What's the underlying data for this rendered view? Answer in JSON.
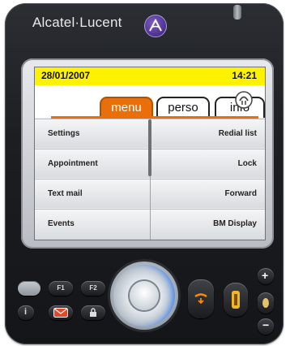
{
  "brand": {
    "name": "Alcatel·Lucent"
  },
  "status": {
    "date": "28/01/2007",
    "time": "14:21"
  },
  "tabs": [
    {
      "label": "menu",
      "active": true
    },
    {
      "label": "perso",
      "active": false
    },
    {
      "label": "info",
      "active": false
    }
  ],
  "menu_left": [
    "Settings",
    "Appointment",
    "Text mail",
    "Events"
  ],
  "menu_right": [
    "Redial list",
    "Lock",
    "Forward",
    "BM Display"
  ],
  "keys": {
    "f1": "F1",
    "f2": "F2"
  },
  "colors": {
    "status_bar": "#fff200",
    "active_tab": "#e86f0a"
  }
}
